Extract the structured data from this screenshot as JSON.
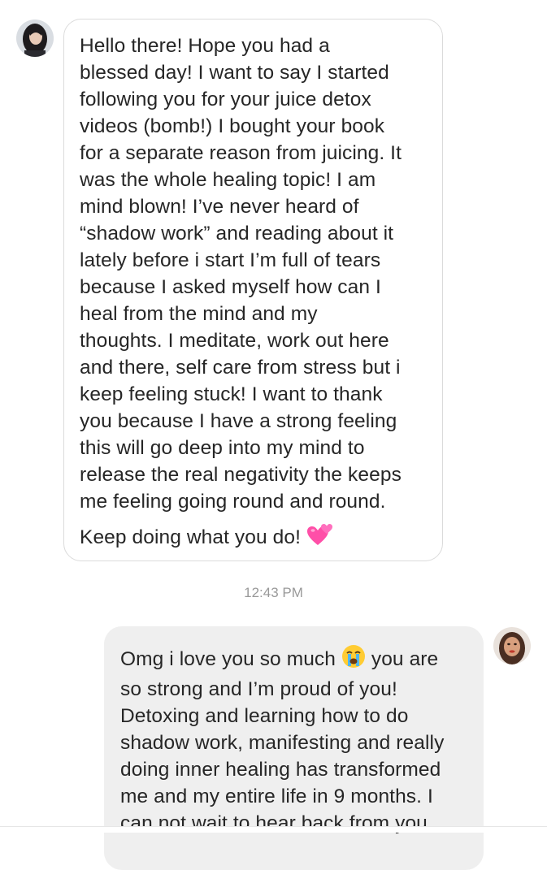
{
  "conversation": {
    "incoming_message": {
      "lines": [
        "Hello there! Hope you had a",
        "blessed day! I want to say I started",
        "following you for your juice detox",
        "videos (bomb!) I bought your book",
        "for a separate reason from juicing. It",
        "was the whole healing topic! I am",
        "mind blown! I’ve never heard of",
        "“shadow work” and reading about it",
        "lately before i start I’m full of tears",
        "because I asked myself how can I",
        "heal from the mind and my",
        "thoughts. I meditate, work out here",
        "and there, self care from stress but i",
        "keep feeling stuck! I want to thank",
        "you because I have a strong feeling",
        "this will go deep into my mind to",
        "release the real negativity the keeps",
        "me feeling going round and round."
      ],
      "closing_line": "Keep doing what you do!",
      "closing_emoji": "two-hearts-emoji"
    },
    "timestamp": "12:43 PM",
    "outgoing_message": {
      "first_line_start": "Omg i love you so much",
      "first_line_emoji": "loudly-crying-face-emoji",
      "first_line_end": "you are",
      "lines": [
        "so strong and I’m proud of you!",
        "Detoxing and learning how to do",
        "shadow work, manifesting and really",
        "doing inner healing has transformed",
        "me and my entire life in 9 months. I",
        "can not wait to hear back from you"
      ]
    }
  },
  "colors": {
    "incoming_bubble_border": "#dbdbdb",
    "outgoing_bubble_bg": "#efefef",
    "text": "#262626",
    "timestamp": "#999999",
    "heart_pink": "#ff4fa8"
  }
}
